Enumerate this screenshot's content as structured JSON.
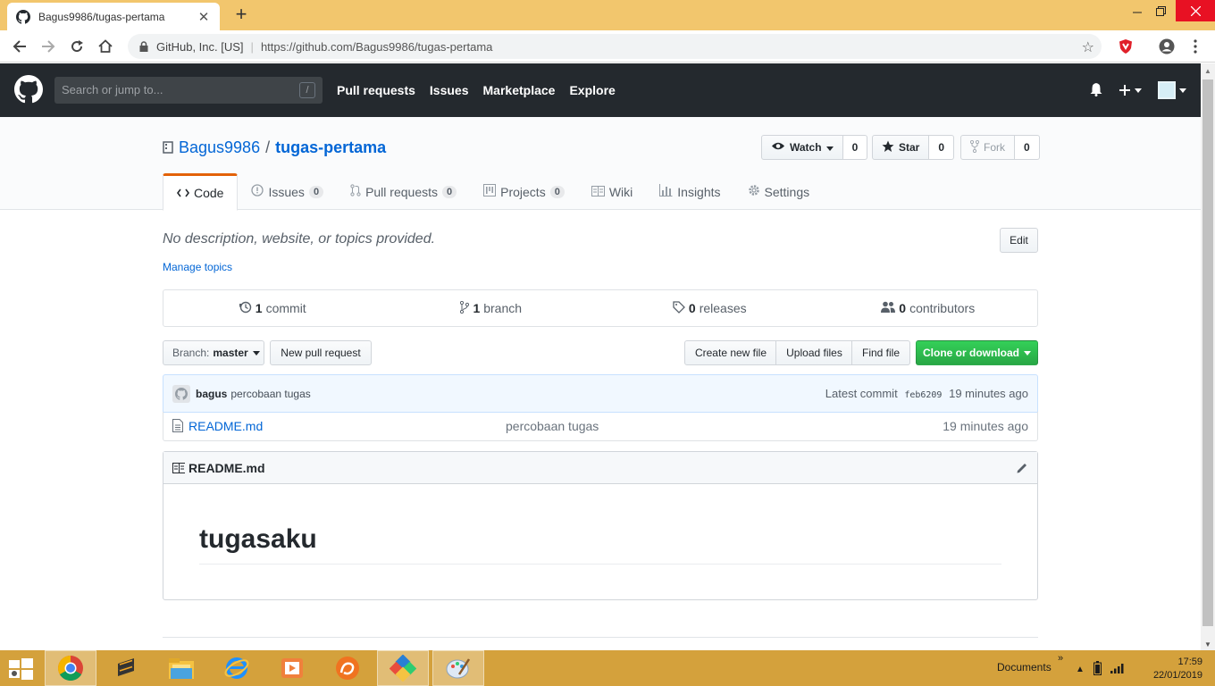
{
  "browser": {
    "tab_title": "Bagus9986/tugas-pertama",
    "site_identity": "GitHub, Inc. [US]",
    "url": "https://github.com/Bagus9986/tugas-pertama",
    "new_tab_glyph": "+",
    "close_glyph": "✕"
  },
  "gh_header": {
    "search_placeholder": "Search or jump to...",
    "search_shortcut": "/",
    "nav": [
      "Pull requests",
      "Issues",
      "Marketplace",
      "Explore"
    ]
  },
  "repo": {
    "owner": "Bagus9986",
    "separator": "/",
    "name": "tugas-pertama",
    "watch": {
      "label": "Watch",
      "count": "0"
    },
    "star": {
      "label": "Star",
      "count": "0"
    },
    "fork": {
      "label": "Fork",
      "count": "0"
    }
  },
  "reponav": [
    {
      "label": "Code",
      "icon": "code-icon",
      "selected": true
    },
    {
      "label": "Issues",
      "icon": "issue-icon",
      "counter": "0"
    },
    {
      "label": "Pull requests",
      "icon": "pull-request-icon",
      "counter": "0"
    },
    {
      "label": "Projects",
      "icon": "project-icon",
      "counter": "0"
    },
    {
      "label": "Wiki",
      "icon": "book-icon"
    },
    {
      "label": "Insights",
      "icon": "graph-icon"
    },
    {
      "label": "Settings",
      "icon": "gear-icon"
    }
  ],
  "summary": {
    "description": "No description, website, or topics provided.",
    "edit_label": "Edit",
    "manage_topics": "Manage topics",
    "numbers": [
      {
        "count": "1",
        "label": "commit",
        "icon": "history-icon"
      },
      {
        "count": "1",
        "label": "branch",
        "icon": "branch-icon"
      },
      {
        "count": "0",
        "label": "releases",
        "icon": "tag-icon"
      },
      {
        "count": "0",
        "label": "contributors",
        "icon": "people-icon"
      }
    ]
  },
  "filebar": {
    "branch_prefix": "Branch:",
    "branch_name": "master",
    "new_pull_request": "New pull request",
    "create_new_file": "Create new file",
    "upload_files": "Upload files",
    "find_file": "Find file",
    "clone": "Clone or download"
  },
  "commit": {
    "author": "bagus",
    "message": "percobaan tugas",
    "latest_label": "Latest commit",
    "sha": "feb6209",
    "age": "19 minutes ago"
  },
  "files": [
    {
      "name": "README.md",
      "message": "percobaan tugas",
      "age": "19 minutes ago"
    }
  ],
  "readme": {
    "filename": "README.md",
    "heading": "tugasaku"
  },
  "taskbar": {
    "documents_label": "Documents",
    "chevron": "»",
    "time": "17:59",
    "date": "22/01/2019"
  },
  "colors": {
    "chrome_frame": "#f2c66d",
    "gh_header": "#24292e",
    "link": "#0366d6",
    "accent_tab": "#e36209",
    "green_button": "#28a745",
    "taskbar": "#d4a13c"
  }
}
